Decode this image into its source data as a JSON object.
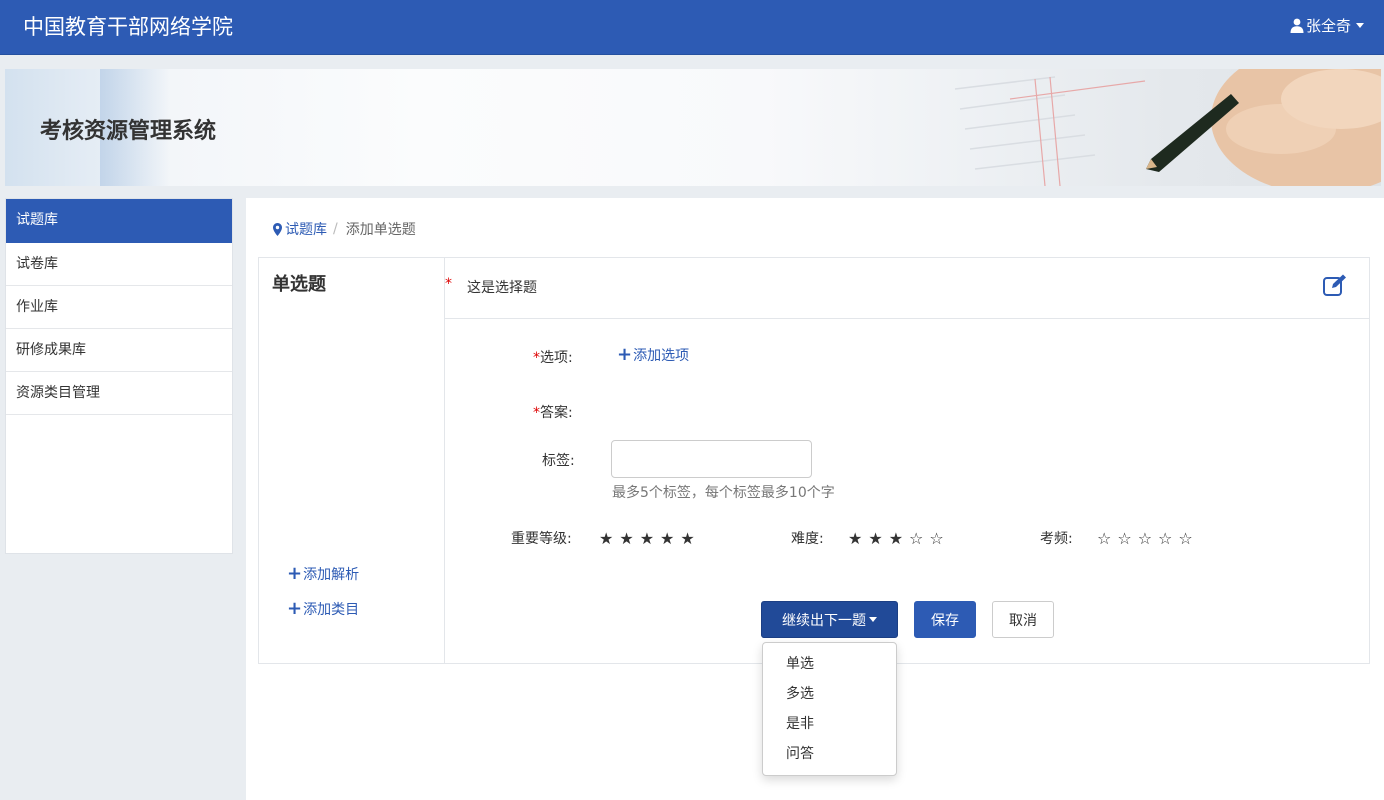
{
  "header": {
    "brand": "中国教育干部网络学院",
    "user_name": "张全奇"
  },
  "banner": {
    "title": "考核资源管理系统"
  },
  "sidebar": {
    "items": [
      {
        "label": "试题库",
        "active": true
      },
      {
        "label": "试卷库",
        "active": false
      },
      {
        "label": "作业库",
        "active": false
      },
      {
        "label": "研修成果库",
        "active": false
      },
      {
        "label": "资源类目管理",
        "active": false
      }
    ]
  },
  "breadcrumb": {
    "root": "试题库",
    "separator": "/",
    "current": "添加单选题"
  },
  "question": {
    "type_title": "单选题",
    "required_mark": "*",
    "text": "这是选择题",
    "options_label": "选项:",
    "add_option": "添加选项",
    "answer_label": "答案:",
    "tag_label": "标签:",
    "tag_value": "",
    "tag_hint": "最多5个标签，每个标签最多10个字",
    "importance_label": "重要等级:",
    "importance_level": 5,
    "difficulty_label": "难度:",
    "difficulty_level": 3,
    "frequency_label": "考频:",
    "frequency_level": 0,
    "max_stars": 5,
    "add_analysis": "添加解析",
    "add_category": "添加类目"
  },
  "actions": {
    "next_label": "继续出下一题",
    "save_label": "保存",
    "cancel_label": "取消",
    "menu": [
      "单选",
      "多选",
      "是非",
      "问答"
    ]
  },
  "colors": {
    "primary": "#2d5bb4",
    "required": "#dd0000"
  }
}
